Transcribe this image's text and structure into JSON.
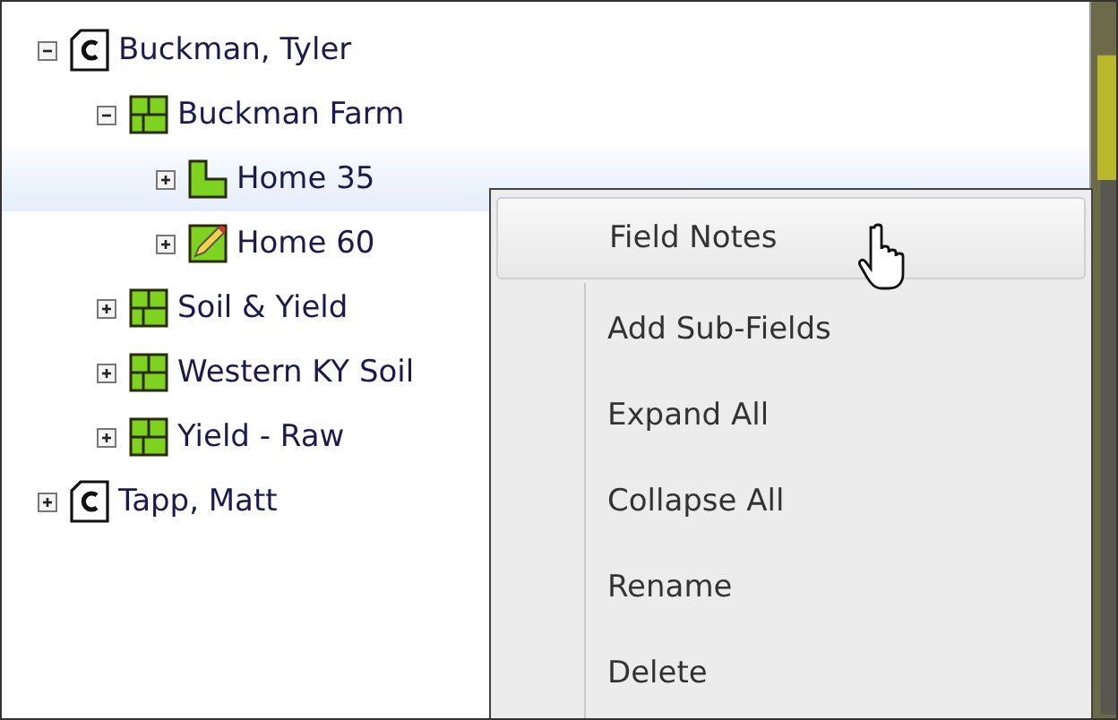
{
  "tree": [
    {
      "label": "Buckman, Tyler",
      "kind": "client",
      "expanded": true,
      "selected": false,
      "children": [
        {
          "label": "Buckman Farm",
          "kind": "farm",
          "expanded": true,
          "selected": false,
          "children": [
            {
              "label": "Home 35",
              "kind": "field",
              "expanded": false,
              "selected": true
            },
            {
              "label": "Home 60",
              "kind": "field-edit",
              "expanded": false,
              "selected": false
            }
          ]
        },
        {
          "label": "Soil & Yield",
          "kind": "farm",
          "expanded": false,
          "selected": false
        },
        {
          "label": "Western KY Soil",
          "kind": "farm",
          "expanded": false,
          "selected": false
        },
        {
          "label": "Yield - Raw",
          "kind": "farm",
          "expanded": false,
          "selected": false
        }
      ]
    },
    {
      "label": "Tapp, Matt",
      "kind": "client",
      "expanded": false,
      "selected": false
    }
  ],
  "context_menu": {
    "items": [
      {
        "label": "Field Notes",
        "selected": true
      },
      {
        "label": "Add Sub-Fields",
        "selected": false
      },
      {
        "label": "Expand All",
        "selected": false
      },
      {
        "label": "Collapse All",
        "selected": false
      },
      {
        "label": "Rename",
        "selected": false
      },
      {
        "label": "Delete",
        "selected": false
      }
    ]
  }
}
